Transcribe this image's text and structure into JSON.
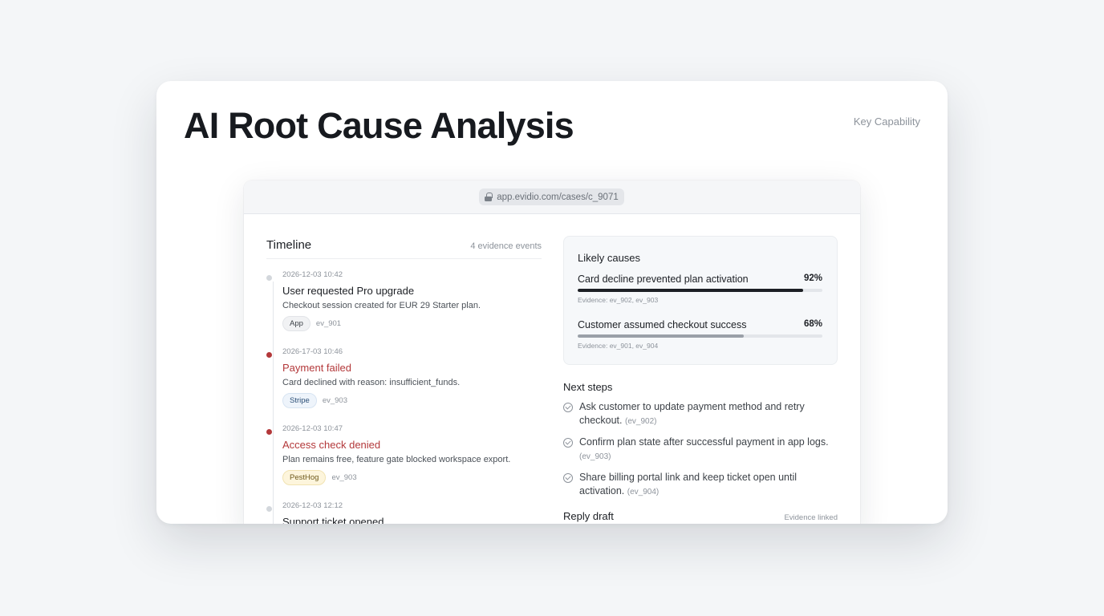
{
  "header": {
    "title": "AI Root Cause Analysis",
    "badge": "Key Capability"
  },
  "browser": {
    "url": "app.evidio.com/cases/c_9071"
  },
  "timeline": {
    "title": "Timeline",
    "count": "4 evidence events",
    "events": [
      {
        "time": "2026-12-03 10:42",
        "title": "User requested Pro upgrade",
        "desc": "Checkout session created for EUR 29 Starter plan.",
        "tag": "App",
        "ref": "ev_901",
        "status": "neutral"
      },
      {
        "time": "2026-17-03 10:46",
        "title": "Payment failed",
        "desc": "Card declined with reason: insufficient_funds.",
        "tag": "Stripe",
        "ref": "ev_903",
        "status": "error"
      },
      {
        "time": "2026-12-03 10:47",
        "title": "Access check denied",
        "desc": "Plan remains free, feature gate blocked workspace export.",
        "tag": "PestHog",
        "ref": "ev_903",
        "status": "error"
      },
      {
        "time": "2026-12-03 12:12",
        "title": "Support ticket opened",
        "status": "neutral"
      }
    ]
  },
  "causes": {
    "title": "Likely causes",
    "items": [
      {
        "label": "Card decline prevented plan activation",
        "pct_label": "92%",
        "pct": 92,
        "evidence": "Evidence: ev_902, ev_903",
        "color": "#1c1f24"
      },
      {
        "label": "Customer assumed checkout success",
        "pct_label": "68%",
        "pct": 68,
        "evidence": "Evidence: ev_901, ev_904",
        "color": "#9aa0a8"
      }
    ]
  },
  "next_steps": {
    "title": "Next steps",
    "items": [
      {
        "text": "Ask customer to update payment method and retry checkout.",
        "ref": "(ev_902)"
      },
      {
        "text": "Confirm plan state after successful payment in app logs.",
        "ref": "(ev_903)"
      },
      {
        "text": "Share billing portal link and keep ticket open until activation.",
        "ref": "(ev_904)"
      }
    ]
  },
  "reply": {
    "title": "Reply draft",
    "badge": "Evidence linked"
  }
}
